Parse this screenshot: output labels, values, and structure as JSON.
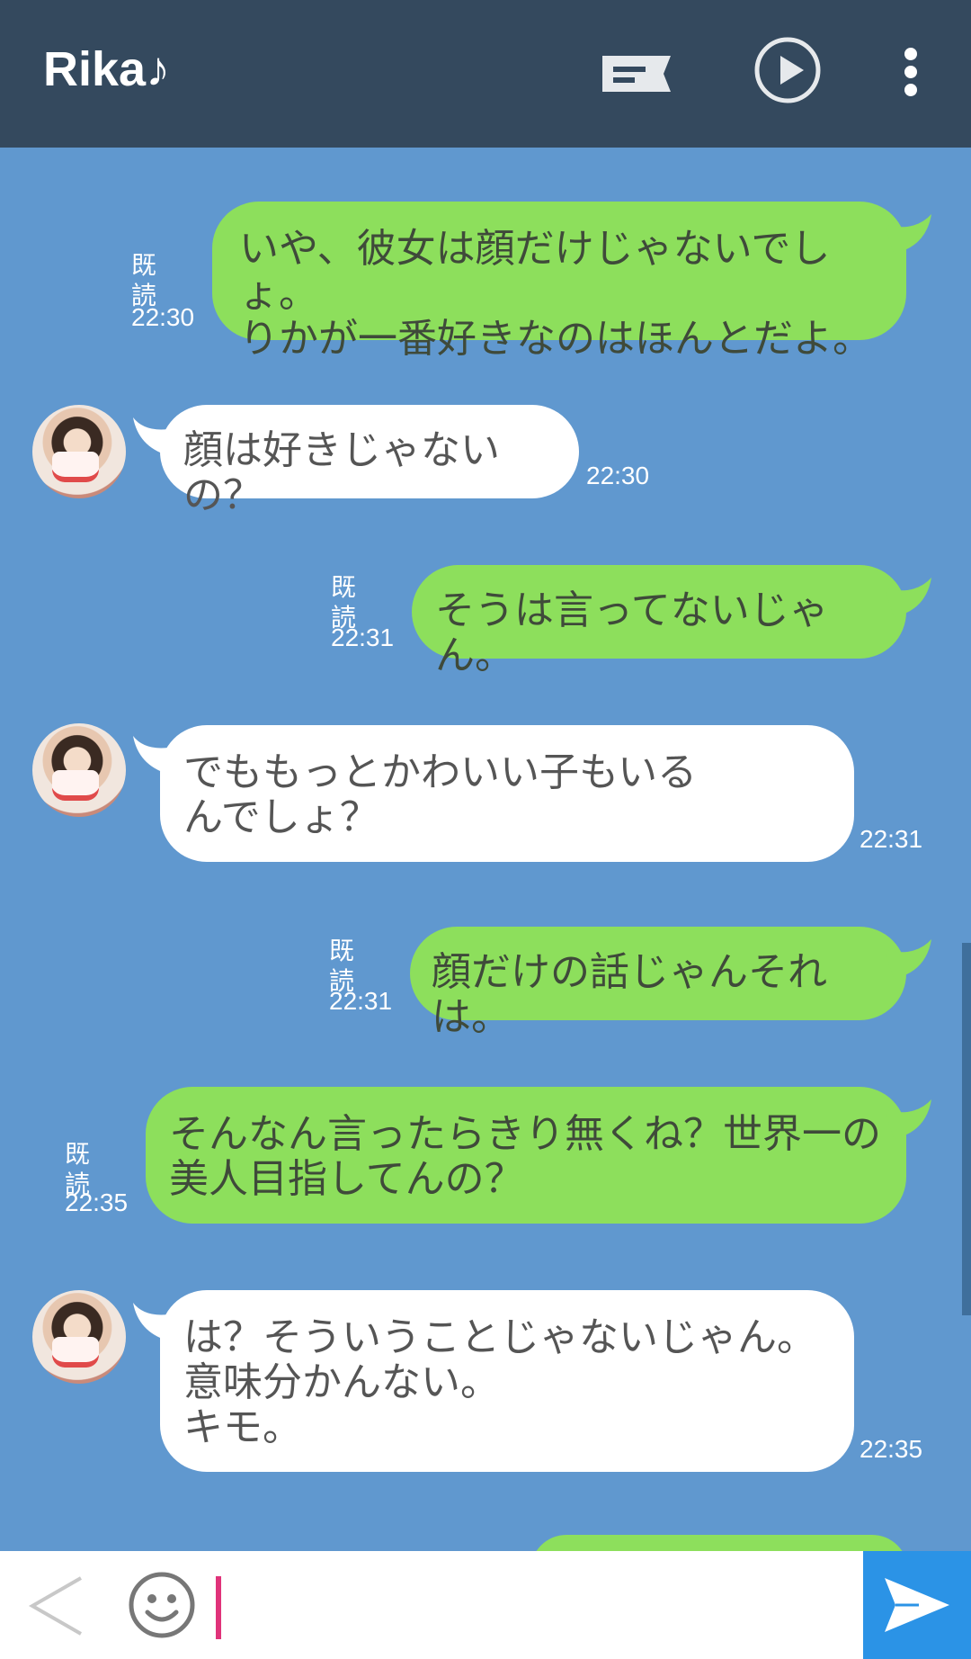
{
  "header": {
    "title": "Rika♪",
    "icons": [
      "chat-note-icon",
      "play-icon",
      "more-vert-icon"
    ],
    "background": "#34495e"
  },
  "colors": {
    "chat_bg": "#6098cf",
    "me_bubble": "#8ddf5c",
    "them_bubble": "#ffffff",
    "send_button": "#2b93e6"
  },
  "messages": [
    {
      "sender": "me",
      "text": "いや、彼女は顔だけじゃないでしょ。\nりかが一番好きなのはほんとだよ。",
      "read": "既読",
      "time": "22:30"
    },
    {
      "sender": "them",
      "text": "顔は好きじゃないの？",
      "time": "22:30"
    },
    {
      "sender": "me",
      "text": "そうは言ってないじゃん。",
      "read": "既読",
      "time": "22:31"
    },
    {
      "sender": "them",
      "text": "でももっとかわいい子もいる\nんでしょ？",
      "time": "22:31"
    },
    {
      "sender": "me",
      "text": "顔だけの話じゃんそれは。",
      "read": "既読",
      "time": "22:31"
    },
    {
      "sender": "me",
      "text": "そんなん言ったらきり無くね？世界一の\n美人目指してんの？",
      "read": "既読",
      "time": "22:35"
    },
    {
      "sender": "them",
      "text": "は？そういうことじゃないじゃん。\n意味分かんない。\nキモ。",
      "time": "22:35"
    }
  ],
  "input": {
    "value": "",
    "icons": [
      "back-chevron-icon",
      "emoji-icon",
      "send-icon"
    ]
  }
}
